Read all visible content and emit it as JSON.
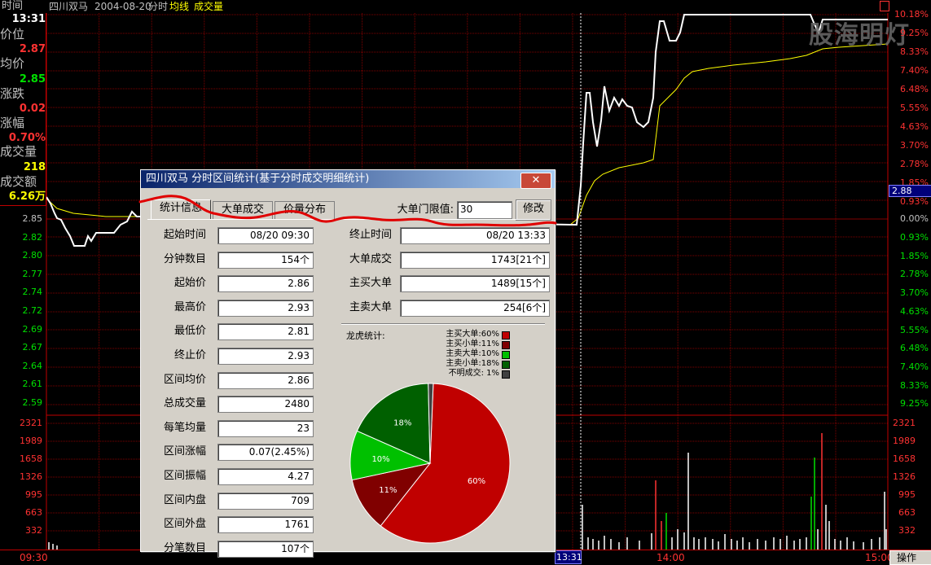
{
  "header": {
    "stock_name": "四川双马",
    "date": "2004-08-20",
    "mode": "分时",
    "avg_line_label": "均线",
    "volume_label": "成交量"
  },
  "watermark": "股海明灯",
  "info_panel": {
    "time_label": "时间",
    "time_value": "13:31",
    "price_label": "价位",
    "price_value": "2.87",
    "avg_label": "均价",
    "avg_value": "2.85",
    "change_label": "涨跌",
    "change_value": "0.02",
    "pct_label": "涨幅",
    "pct_value": "0.70%",
    "vol_label": "成交量",
    "vol_value": "218",
    "amount_label": "成交额",
    "amount_value": "6.26万"
  },
  "price_axis": {
    "left": [
      "2.85",
      "2.82",
      "2.80",
      "2.77",
      "2.74",
      "2.72",
      "2.69",
      "2.67",
      "2.64",
      "2.61",
      "2.59"
    ],
    "right_up": [
      "10.18%",
      "9.25%",
      "8.33%",
      "7.40%",
      "6.48%",
      "5.55%",
      "4.63%",
      "3.70%",
      "2.78%",
      "1.85%",
      "0.93%"
    ],
    "right_cursor": "2.88",
    "right_zero": "0.00%",
    "right_down": [
      "0.93%",
      "1.85%",
      "2.78%",
      "3.70%",
      "4.63%",
      "5.55%",
      "6.48%",
      "7.40%",
      "8.33%",
      "9.25%"
    ]
  },
  "volume_axis": [
    "2321",
    "1989",
    "1658",
    "1326",
    "995",
    "663",
    "332"
  ],
  "time_axis": {
    "start": "09:30",
    "cursor": "13:31",
    "mid": "14:00",
    "end": "15:00",
    "ops": "操作"
  },
  "dialog": {
    "title": "四川双马 分时区间统计(基于分时成交明细统计)",
    "close_label": "✕",
    "tabs": [
      "统计信息",
      "大单成交",
      "价量分布"
    ],
    "threshold_label": "大单门限值:",
    "threshold_value": "30",
    "modify_button": "修改",
    "left_rows": [
      {
        "label": "起始时间",
        "value": "08/20 09:30"
      },
      {
        "label": "分钟数目",
        "value": "154个"
      },
      {
        "label": "起始价",
        "value": "2.86"
      },
      {
        "label": "最高价",
        "value": "2.93"
      },
      {
        "label": "最低价",
        "value": "2.81"
      },
      {
        "label": "终止价",
        "value": "2.93"
      },
      {
        "label": "区间均价",
        "value": "2.86"
      },
      {
        "label": "总成交量",
        "value": "2480"
      },
      {
        "label": "每笔均量",
        "value": "23"
      },
      {
        "label": "区间涨幅",
        "value": "0.07(2.45%)"
      },
      {
        "label": "区间振幅",
        "value": "4.27"
      },
      {
        "label": "区间内盘",
        "value": "709"
      },
      {
        "label": "区间外盘",
        "value": "1761"
      },
      {
        "label": "分笔数目",
        "value": "107个"
      }
    ],
    "right_rows": [
      {
        "label": "终止时间",
        "value": "08/20 13:33"
      },
      {
        "label": "大单成交",
        "value": "1743[21个]"
      },
      {
        "label": "主买大单",
        "value": "1489[15个]"
      },
      {
        "label": "主卖大单",
        "value": "254[6个]"
      }
    ],
    "pie_title": "龙虎统计:",
    "legend": [
      {
        "label": "主买大单:60%",
        "color": "#c00000"
      },
      {
        "label": "主买小单:11%",
        "color": "#800000"
      },
      {
        "label": "主卖大单:10%",
        "color": "#00c000"
      },
      {
        "label": "主卖小单:18%",
        "color": "#006000"
      },
      {
        "label": "不明成交: 1%",
        "color": "#404040"
      }
    ],
    "pie_slices": [
      {
        "pct": 60,
        "label": "60%",
        "color": "#c00000"
      },
      {
        "pct": 11,
        "label": "11%",
        "color": "#800000"
      },
      {
        "pct": 10,
        "label": "10%",
        "color": "#00c000"
      },
      {
        "pct": 18,
        "label": "18%",
        "color": "#006000"
      },
      {
        "pct": 1,
        "label": "",
        "color": "#404040"
      }
    ]
  },
  "colors": {
    "up": "#ff3232",
    "down": "#00e000",
    "grid": "#800000",
    "avg": "#ffff00",
    "price": "#ffffff"
  }
}
